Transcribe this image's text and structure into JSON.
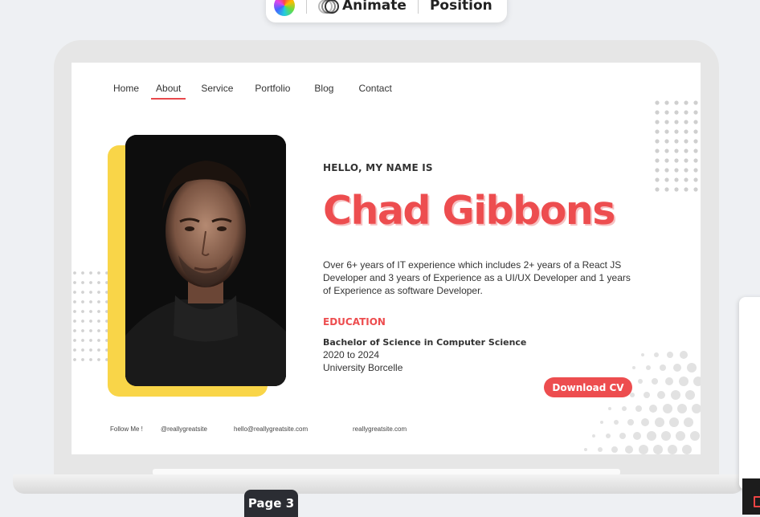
{
  "toolbar": {
    "animate_label": "Animate",
    "position_label": "Position"
  },
  "nav": {
    "items": [
      "Home",
      "About",
      "Service",
      "Portfolio",
      "Blog",
      "Contact"
    ],
    "active": "About"
  },
  "hero": {
    "greeting": "HELLO, MY NAME IS",
    "name": "Chad Gibbons",
    "bio": "Over 6+ years of IT experience which includes 2+ years of a React JS Developer and 3 years of Experience as a UI/UX Developer and 1 years of Experience as software Developer.",
    "education_heading": "EDUCATION",
    "degree": "Bachelor of Science in Computer Science",
    "years": "2020 to 2024",
    "university": "University Borcelle",
    "cv_button": "Download CV"
  },
  "footer": {
    "follow": "Follow Me !",
    "handle": "@reallygreatsite",
    "email": "hello@reallygreatsite.com",
    "website": "reallygreatsite.com"
  },
  "page_tag": "Page 3",
  "colors": {
    "accent": "#ed4d4f",
    "yellow": "#f9d548",
    "dots": "#cfcfcf"
  }
}
